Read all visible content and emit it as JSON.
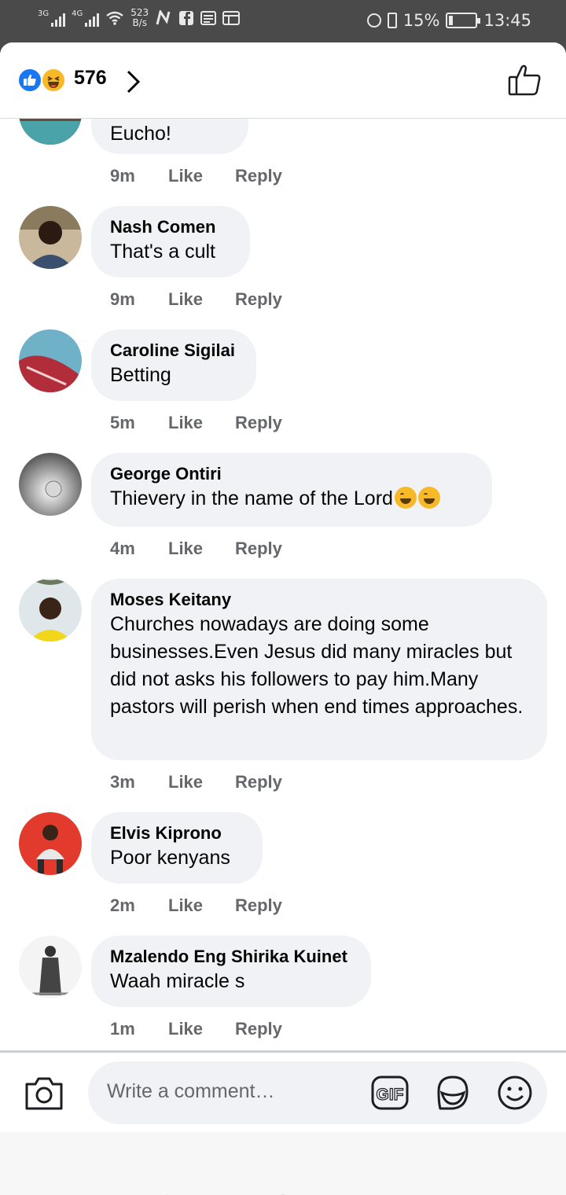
{
  "status_bar": {
    "net1": "3G",
    "net2": "4G",
    "speed_value": "523",
    "speed_unit": "B/s",
    "battery": "15%",
    "battery_level": 0.15,
    "time": "13:45"
  },
  "header": {
    "reaction_count": "576",
    "reactions": [
      "like-icon",
      "haha-icon"
    ]
  },
  "comments": [
    {
      "name": "",
      "text": "Eucho!",
      "time": "9m",
      "like": "Like",
      "reply": "Reply"
    },
    {
      "name": "Nash Comen",
      "text": "That's a cult",
      "time": "9m",
      "like": "Like",
      "reply": "Reply"
    },
    {
      "name": "Caroline Sigilai",
      "text": "Betting",
      "time": "5m",
      "like": "Like",
      "reply": "Reply"
    },
    {
      "name": "George Ontiri",
      "text": "Thievery in the name of the Lord",
      "time": "4m",
      "like": "Like",
      "reply": "Reply"
    },
    {
      "name": "Moses Keitany",
      "text": "Churches nowadays are doing some businesses.Even Jesus did many miracles but did not asks his followers to pay him.Many pastors will perish when end times approaches.",
      "time": "3m",
      "like": "Like",
      "reply": "Reply"
    },
    {
      "name": "Elvis Kiprono",
      "text": "Poor kenyans",
      "time": "2m",
      "like": "Like",
      "reply": "Reply"
    },
    {
      "name": "Mzalendo Eng Shirika Kuinet",
      "text": "Waah miracle s",
      "time": "1m",
      "like": "Like",
      "reply": "Reply"
    }
  ],
  "composer": {
    "placeholder": "Write a comment…",
    "gif_label": "GIF"
  },
  "colors": {
    "accent_blue": "#1877f2",
    "bubble_bg": "#f0f2f5",
    "meta_gray": "#65676b"
  }
}
